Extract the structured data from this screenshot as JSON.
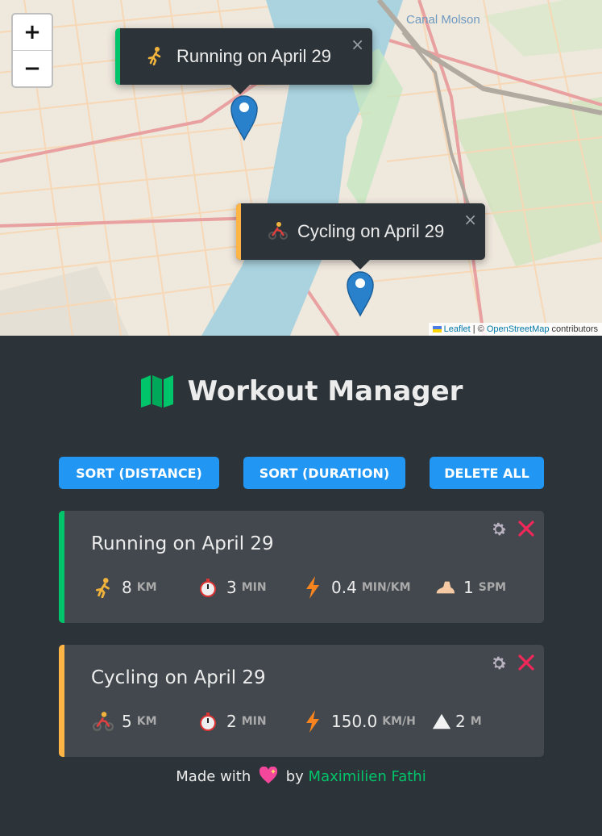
{
  "map": {
    "place_label": "Canal Molson",
    "zoom_in": "+",
    "zoom_out": "−",
    "attribution": {
      "leaflet": "Leaflet",
      "separator": " | © ",
      "osm": "OpenStreetMap",
      "suffix": " contributors"
    },
    "popups": [
      {
        "text": "Running on April 29",
        "close": "×",
        "accent": "#00c46a",
        "emoji": "runner-icon"
      },
      {
        "text": "Cycling on April 29",
        "close": "×",
        "accent": "#ffb545",
        "emoji": "cyclist-icon"
      }
    ]
  },
  "app": {
    "title": "Workout Manager",
    "buttons": {
      "sort_distance": "SORT (DISTANCE)",
      "sort_duration": "SORT (DURATION)",
      "delete_all": "DELETE ALL"
    }
  },
  "workouts": [
    {
      "title": "Running on April 29",
      "accent": "#00c46a",
      "details": [
        {
          "icon": "runner-icon",
          "value": "8",
          "unit": "KM"
        },
        {
          "icon": "stopwatch-icon",
          "value": "3",
          "unit": "MIN"
        },
        {
          "icon": "lightning-icon",
          "value": "0.4",
          "unit": "MIN/KM"
        },
        {
          "icon": "foot-icon",
          "value": "1",
          "unit": "SPM"
        }
      ]
    },
    {
      "title": "Cycling on April 29",
      "accent": "#ffb545",
      "details": [
        {
          "icon": "cyclist-icon",
          "value": "5",
          "unit": "KM"
        },
        {
          "icon": "stopwatch-icon",
          "value": "2",
          "unit": "MIN"
        },
        {
          "icon": "lightning-icon",
          "value": "150.0",
          "unit": "KM/H"
        },
        {
          "icon": "mountain-icon",
          "value": "2",
          "unit": "M"
        }
      ]
    }
  ],
  "footer": {
    "prefix": "Made with",
    "by": "by",
    "author": "Maximilien Fathi"
  },
  "colors": {
    "running": "#00c46a",
    "cycling": "#ffb545",
    "primary": "#2196f3",
    "dark": "#2d3439",
    "card": "#42484d",
    "delete": "#f0285a"
  }
}
